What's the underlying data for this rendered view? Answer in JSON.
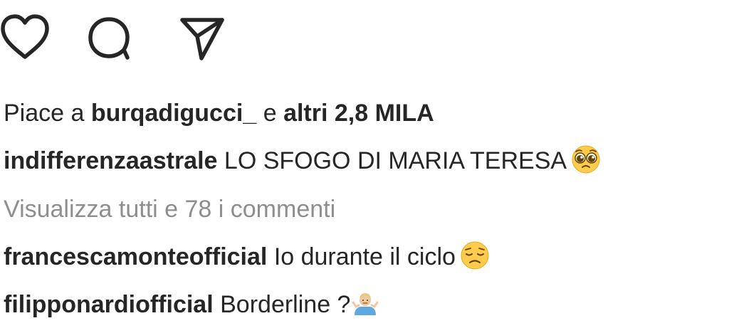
{
  "actions": {
    "like_icon": "heart-outline",
    "comment_icon": "speech-bubble",
    "share_icon": "paper-plane"
  },
  "likes": {
    "prefix": "Piace a",
    "user": "burqadigucci_",
    "connector": "e",
    "others": "altri 2,8 MILA"
  },
  "caption": {
    "username": "indifferenzaastrale",
    "text": "LO SFOGO DI MARIA TERESA",
    "emoji": "pleading-face"
  },
  "view_all_comments": "Visualizza tutti e 78 i commenti",
  "comments": [
    {
      "username": "francescamonteofficial",
      "text": "Io durante il ciclo",
      "emoji": "disappointed-face"
    },
    {
      "username": "filipponardiofficial",
      "text": "Borderline ?",
      "emoji": "person-shrugging"
    }
  ],
  "colors": {
    "text": "#262626",
    "muted": "#8e8e8e",
    "emoji_yellow": "#ffcc4d"
  }
}
